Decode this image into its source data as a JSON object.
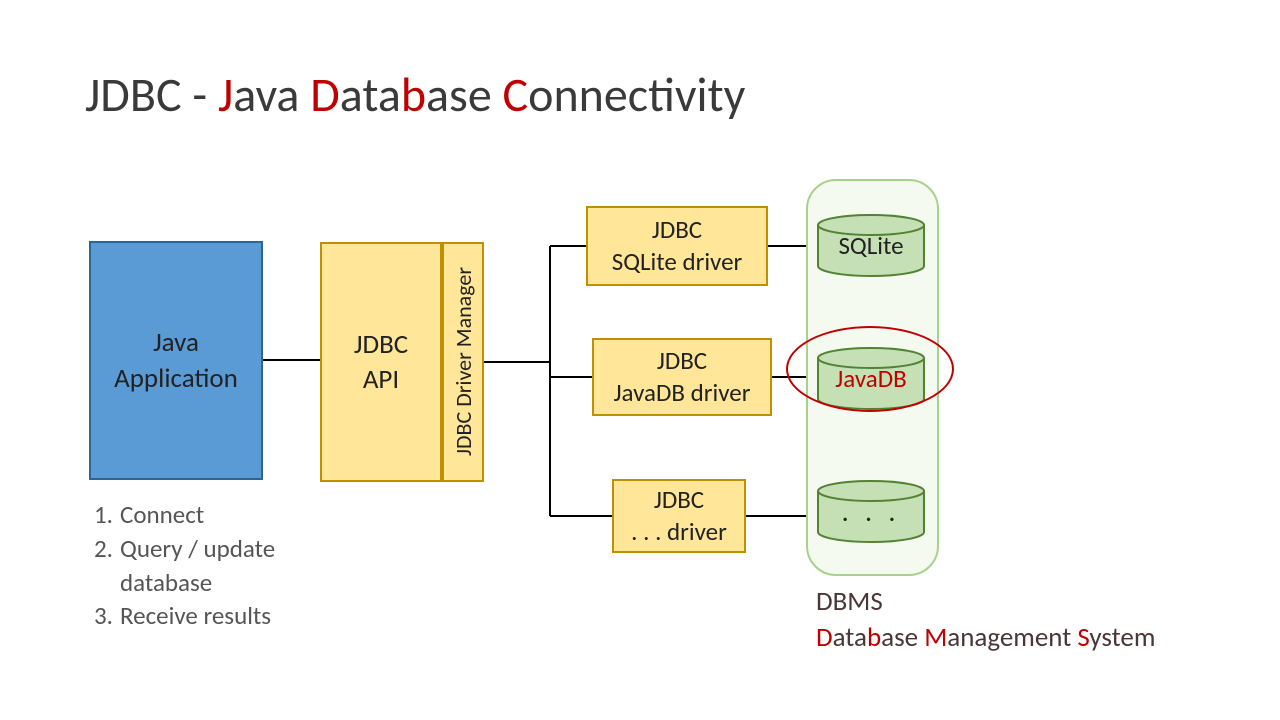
{
  "title": {
    "prefix": "JDBC - ",
    "j": "J",
    "ava": "ava ",
    "d": "D",
    "ata": "ata",
    "b": "b",
    "ase": "ase ",
    "c": "C",
    "onnectivity": "onnectivity"
  },
  "java_app": {
    "line1": "Java",
    "line2": "Application"
  },
  "jdbc_api": {
    "line1": "JDBC",
    "line2": "API"
  },
  "driver_manager": "JDBC Driver Manager",
  "drivers": [
    {
      "line1": "JDBC",
      "line2": "SQLite driver"
    },
    {
      "line1": "JDBC",
      "line2": "JavaDB driver"
    },
    {
      "line1": "JDBC",
      "line2": ". . . driver"
    }
  ],
  "databases": [
    {
      "label": "SQLite",
      "highlighted": false
    },
    {
      "label": "JavaDB",
      "highlighted": true
    },
    {
      "label": ". . .",
      "highlighted": false
    }
  ],
  "steps": [
    {
      "num": "1.",
      "text": "Connect"
    },
    {
      "num": "2.",
      "text": "Query / update",
      "text2": "database"
    },
    {
      "num": "3.",
      "text": "Receive results"
    }
  ],
  "dbms": {
    "line1": "DBMS",
    "d": "D",
    "ata": "ata",
    "b": "b",
    "ase": "ase ",
    "m": "M",
    "anagement": "anagement ",
    "s": "S",
    "ystem": "ystem"
  },
  "colors": {
    "accent_red": "#c00000",
    "box_yellow": "#ffe699",
    "box_yellow_border": "#bf9000",
    "box_blue": "#5b9bd5",
    "box_blue_border": "#2f6595",
    "db_green": "#c5e0b4",
    "db_green_border": "#548235",
    "container_green": "#f4faef",
    "container_border": "#a9d18e"
  }
}
